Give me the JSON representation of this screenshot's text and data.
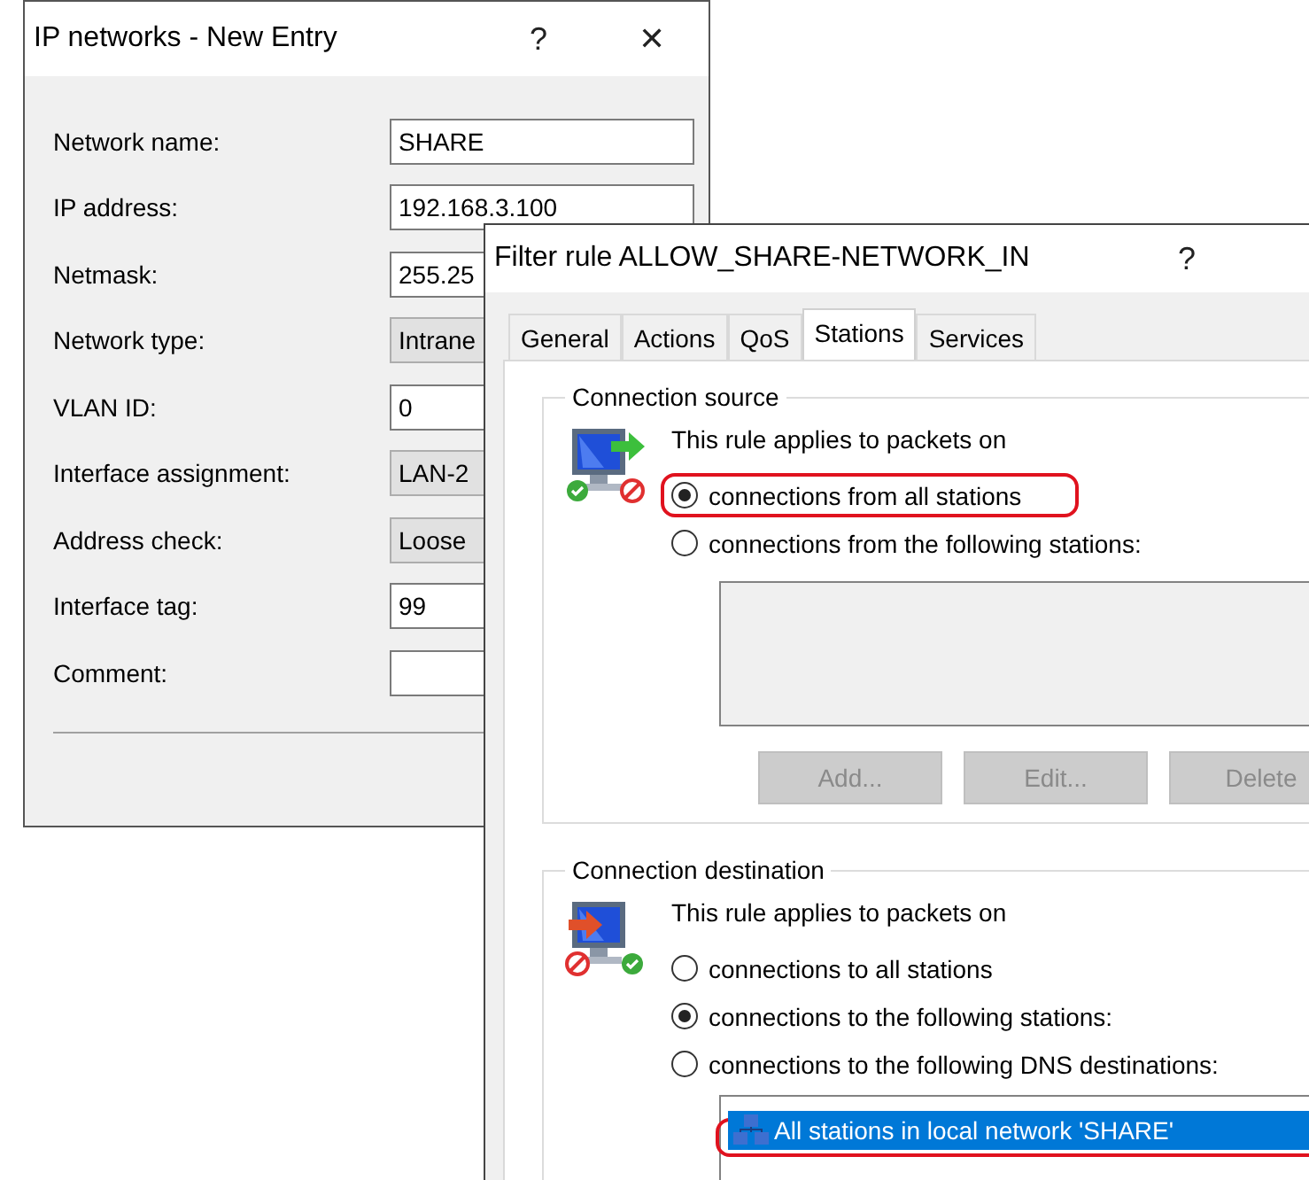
{
  "network_window": {
    "title": "IP networks - New Entry",
    "help_button": "?",
    "close_button": "✕",
    "fields": [
      {
        "label": "Network name:",
        "value": "SHARE",
        "kind": "text"
      },
      {
        "label": "IP address:",
        "value": "192.168.3.100",
        "kind": "text"
      },
      {
        "label": "Netmask:",
        "value": "255.25",
        "kind": "text"
      },
      {
        "label": "Network type:",
        "value": "Intrane",
        "kind": "select"
      },
      {
        "label": "VLAN ID:",
        "value": "0",
        "kind": "text"
      },
      {
        "label": "Interface assignment:",
        "value": "LAN-2",
        "kind": "select"
      },
      {
        "label": "Address check:",
        "value": "Loose",
        "kind": "select"
      },
      {
        "label": "Interface tag:",
        "value": "99",
        "kind": "text"
      },
      {
        "label": "Comment:",
        "kind": "text"
      }
    ]
  },
  "filter_window": {
    "title": "Filter rule ALLOW_SHARE-NETWORK_IN",
    "help_button": "?",
    "tabs": [
      {
        "label": "General",
        "selected": false
      },
      {
        "label": "Actions",
        "selected": false
      },
      {
        "label": "QoS",
        "selected": false
      },
      {
        "label": "Stations",
        "selected": true
      },
      {
        "label": "Services",
        "selected": false
      }
    ],
    "groups": [
      {
        "kind": "source",
        "title": "Connection source",
        "intro": "This rule applies to packets on",
        "options": [
          {
            "label": "connections from all stations",
            "selected": true,
            "highlighted": true
          },
          {
            "label": "connections from the following stations:",
            "selected": false,
            "highlighted": false
          }
        ],
        "buttons": [
          {
            "label": "Add...",
            "disabled": true
          },
          {
            "label": "Edit...",
            "disabled": true
          },
          {
            "label": "Delete",
            "disabled": true
          }
        ]
      },
      {
        "kind": "destination",
        "title": "Connection destination",
        "intro": "This rule applies to packets on",
        "options": [
          {
            "label": "connections to all stations",
            "selected": false,
            "highlighted": false
          },
          {
            "label": "connections to the following stations:",
            "selected": true,
            "highlighted": false
          },
          {
            "label": "connections to the following DNS destinations:",
            "selected": false,
            "highlighted": false
          }
        ],
        "list_items": [
          {
            "label": "All stations in local network 'SHARE'",
            "selected": true,
            "highlighted": true
          }
        ]
      }
    ]
  }
}
